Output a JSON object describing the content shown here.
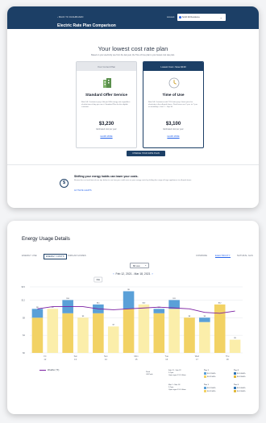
{
  "top": {
    "back_label": "BACK TO DASHBOARD",
    "account_label": "Account",
    "account_value": "Smith Rd Residence",
    "page_title": "Electric Rate Plan Comparison",
    "hero_heading": "Your lowest cost rate plan",
    "hero_sub": "Based on your electricity use from the last year, the Time of Use plan is your lowest cost rate plan.",
    "plans": [
      {
        "header": "Your Current Plan",
        "name": "Standard Offer Service",
        "desc": "Rate 1A. Customers pay a flat per kWh energy rate regardless of what time of day you use it. Standard Plan for the eligible customer.",
        "price": "$3,230",
        "per": "Estimated cost per year",
        "link": "LEARN MORE"
      },
      {
        "header": "Lowest Cost • Save $130",
        "name": "Time of Use",
        "desc": "Rate 1A. Customers with TOU rates pay a lower price for electricity in the off-peak hours. Peak hours are 2 p.m. to 7 p.m. on weekdays, June 1 – Sep 30.",
        "price": "$3,100",
        "per": "Estimated cost per year",
        "link": "LEARN MORE"
      }
    ],
    "cta_label": "CHANGE YOUR RATE PLAN",
    "shift": {
      "icon": "$",
      "title": "Shifting your energy habits can lower your costs.",
      "desc": "Review the cost and time-of-use tips below to see how you could save on your energy costs by shifting the usage of large appliances to off-peak times.",
      "link": "ACTIVATE ALERTS"
    }
  },
  "bottom": {
    "title": "Energy Usage Details",
    "tabs": [
      "ENERGY USE",
      "ENERGY COSTS",
      "SIMILAR HOMES"
    ],
    "right_tabs": [
      "COMPARE",
      "ELECTRICITY",
      "NATURAL GAS"
    ],
    "view_label": "Bill view",
    "range_label": "Feb 12, 2021 - Mar 18, 2021",
    "legend_label": "Weather (°F)",
    "tooltip": "Max",
    "peak_label": "Peak",
    "offpeak_label": "Off Peak",
    "periods": [
      {
        "dates": "Feb 12 - Feb 22",
        "peak": "2-7pm",
        "offpeak": "Open ages 11-1:00am"
      },
      {
        "dates": "Mar 1 - Mar 18",
        "peak": "2-7pm",
        "offpeak": "Open ages 11-1:00am"
      }
    ],
    "tiers": [
      {
        "name": "Tier 1",
        "price1": "$0.12/kWh",
        "price2": "$0.11/kWh"
      },
      {
        "name": "Tier 2",
        "price1": "$0.14/kWh",
        "price2": "$0.13/kWh"
      },
      {
        "name": "Tier 1",
        "price1": "$0.12/kWh",
        "price2": "$0.11/kWh"
      },
      {
        "name": "Tier 2",
        "price1": "$0.14/kWh",
        "price2": "$0.13/kWh"
      }
    ],
    "colors": {
      "peak": "#5aa0d8",
      "offpeak": "#f2d264",
      "offpeak_light": "#fbeeaa",
      "weather": "#7b1fa2",
      "brand": "#1c3f66"
    }
  },
  "chart_data": {
    "type": "bar",
    "ylim": [
      0,
      15
    ],
    "ylabels": [
      "$0",
      "$4",
      "$8",
      "$12",
      "$15"
    ],
    "categories": [
      "Fri 12",
      "",
      "Sat 13",
      "",
      "Sun 14",
      "",
      "Mon 15",
      "",
      "Tue 16",
      "",
      "Wed 17",
      "",
      "Thu 18",
      ""
    ],
    "xlabels": [
      "Fri\n12",
      "Sat\n13",
      "Sun\n14",
      "Mon\n15",
      "Tue\n16",
      "Wed\n17",
      "Thu\n18"
    ],
    "series": [
      {
        "name": "Peak",
        "values": [
          2,
          0,
          3,
          0,
          2,
          0,
          4,
          0,
          1,
          2,
          0,
          1,
          0,
          0
        ]
      },
      {
        "name": "Off Peak",
        "values": [
          8,
          10,
          9,
          8,
          9,
          6,
          10,
          11,
          9,
          10,
          8,
          7,
          11,
          3
        ]
      }
    ],
    "data_labels": [
      "$8",
      "$9",
      "$10",
      "$9",
      "$11",
      "$7",
      "$9",
      "$10",
      "$10",
      "$11",
      "$8",
      "$9",
      "$12",
      "$3"
    ],
    "weather": [
      10,
      10.5,
      10.5,
      10.5,
      10,
      9.8,
      10,
      10.2,
      10.4,
      10.2,
      10,
      9.2,
      9,
      9.5
    ]
  }
}
